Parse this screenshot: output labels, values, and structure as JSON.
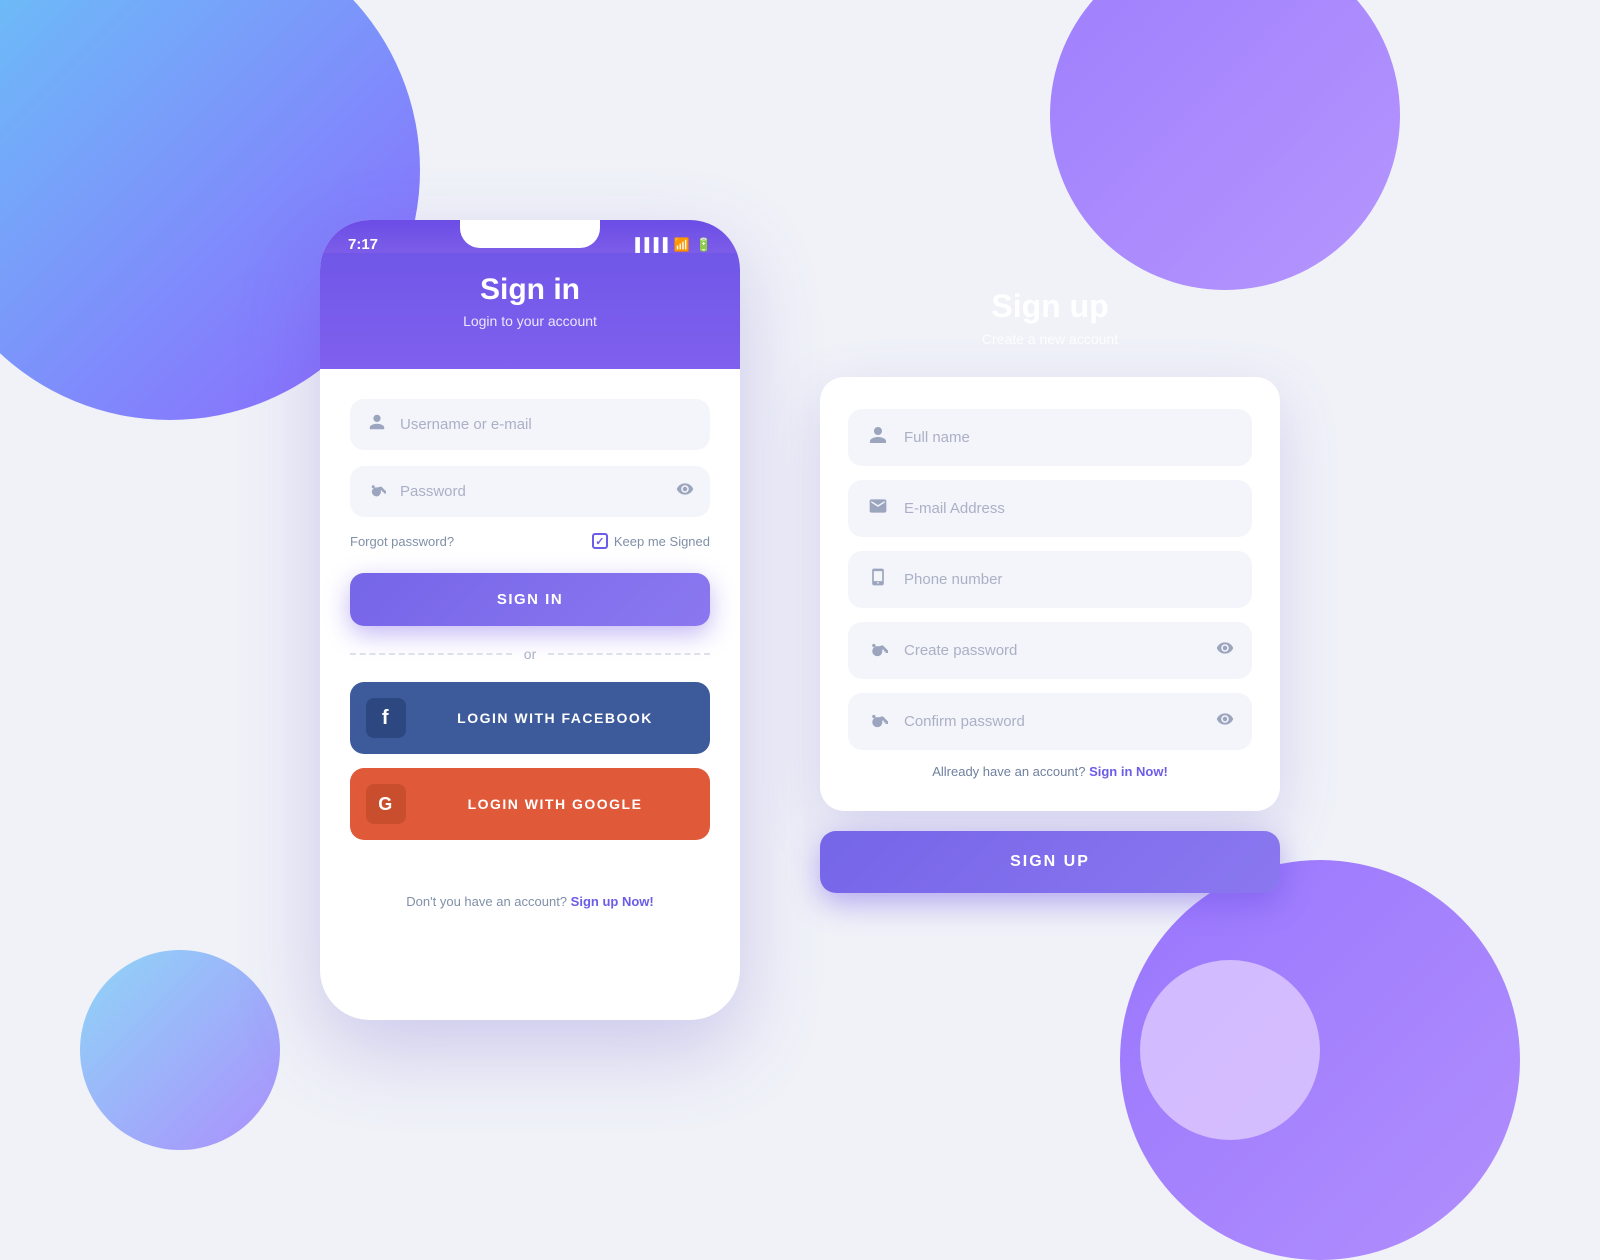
{
  "background": {
    "color": "#f0f2f8"
  },
  "signin": {
    "status_time": "7:17",
    "title": "Sign in",
    "subtitle": "Login to your account",
    "username_placeholder": "Username or e-mail",
    "password_placeholder": "Password",
    "forgot_password": "Forgot password?",
    "keep_signed": "Keep me Signed",
    "signin_button": "SIGN IN",
    "or_text": "or",
    "facebook_button": "LOGIN WITH FACEBOOK",
    "google_button": "LOGIN WITH GOOGLE",
    "footer_text": "Don't you have an account?",
    "footer_link": "Sign up Now!"
  },
  "signup": {
    "title": "Sign up",
    "subtitle": "Create a new account",
    "fullname_placeholder": "Full name",
    "email_placeholder": "E-mail Address",
    "phone_placeholder": "Phone number",
    "create_password_placeholder": "Create password",
    "confirm_password_placeholder": "Confirm password",
    "already_text": "Allready have an account?",
    "already_link": "Sign in Now!",
    "signup_button": "SIGN UP"
  }
}
